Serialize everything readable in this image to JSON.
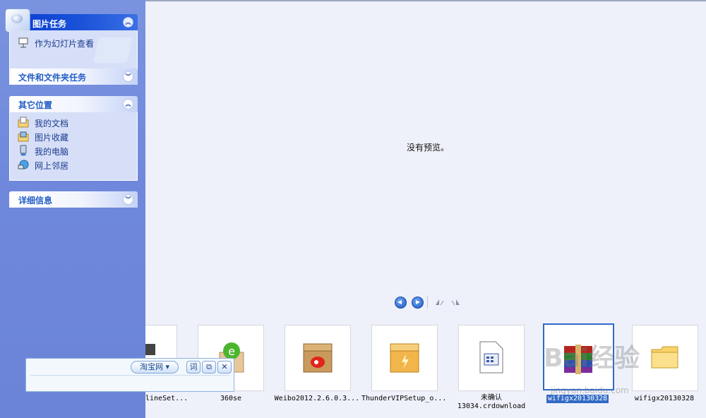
{
  "taskpane": {
    "picture_tasks": {
      "title": "图片任务",
      "items": [
        {
          "label": "作为幻灯片查看",
          "icon": "slideshow-icon"
        }
      ]
    },
    "file_tasks": {
      "title": "文件和文件夹任务"
    },
    "other_places": {
      "title": "其它位置",
      "items": [
        {
          "label": "我的文档",
          "icon": "my-documents-icon"
        },
        {
          "label": "图片收藏",
          "icon": "my-pictures-icon"
        },
        {
          "label": "我的电脑",
          "icon": "my-computer-icon"
        },
        {
          "label": "网上邻居",
          "icon": "network-places-icon"
        }
      ]
    },
    "details": {
      "title": "详细信息"
    }
  },
  "preview": {
    "message": "没有预览。"
  },
  "controls": {
    "prev": "previous-image-icon",
    "next": "next-image-icon",
    "rotate_cw": "rotate-clockwise-icon",
    "rotate_ccw": "rotate-counterclockwise-icon"
  },
  "filmstrip": [
    {
      "name": "lineSet...",
      "icon": "installer-icon"
    },
    {
      "name": "360se",
      "icon": "360se-icon"
    },
    {
      "name": "Weibo2012.2.6.0.3...",
      "icon": "weibo-box-icon"
    },
    {
      "name": "ThunderVIPSetup_o...",
      "icon": "thunder-box-icon"
    },
    {
      "name": "未确认",
      "name2": "13034.crdownload",
      "icon": "crdownload-file-icon"
    },
    {
      "name": "wifigx20130328",
      "icon": "winrar-archive-icon",
      "selected": true
    },
    {
      "name": "wifigx20130328",
      "icon": "folder-icon"
    }
  ],
  "floating_bar": {
    "dropdown": "淘宝网",
    "btn_ci": "词",
    "btn_copy": "⧉",
    "close": "✕"
  },
  "watermark": {
    "brand": "Bai经验",
    "url": "jingyan.baidu.com"
  },
  "colors": {
    "pane": "#6f88dc",
    "selection": "#316ac5",
    "special_header": "#0a3ad1"
  }
}
